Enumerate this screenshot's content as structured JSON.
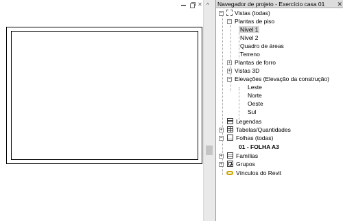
{
  "view": {
    "controls": {
      "close_glyph": "✕"
    },
    "scroll_up_glyph": "^"
  },
  "browser": {
    "title": "Navegador de projeto - Exercício casa 01",
    "close_glyph": "✕",
    "expand_minus": "−",
    "expand_plus": "+",
    "tree": {
      "views": "Vistas (todas)",
      "floor_plans": "Plantas de piso",
      "nivel1": "Nível 1",
      "nivel2": "Nível 2",
      "quadro_areas": "Quadro de áreas",
      "terreno": "Terreno",
      "ceiling_plans": "Plantas de forro",
      "views_3d": "Vistas 3D",
      "elevations": "Elevações (Elevação da construção)",
      "leste": "Leste",
      "norte": "Norte",
      "oeste": "Oeste",
      "sul": "Sul",
      "legends": "Legendas",
      "schedules": "Tabelas/Quantidades",
      "sheets": "Folhas (todas)",
      "sheet01": "01 - FOLHA A3",
      "families": "Famílias",
      "groups": "Grupos",
      "revit_links": "Vínculos do Revit"
    }
  }
}
